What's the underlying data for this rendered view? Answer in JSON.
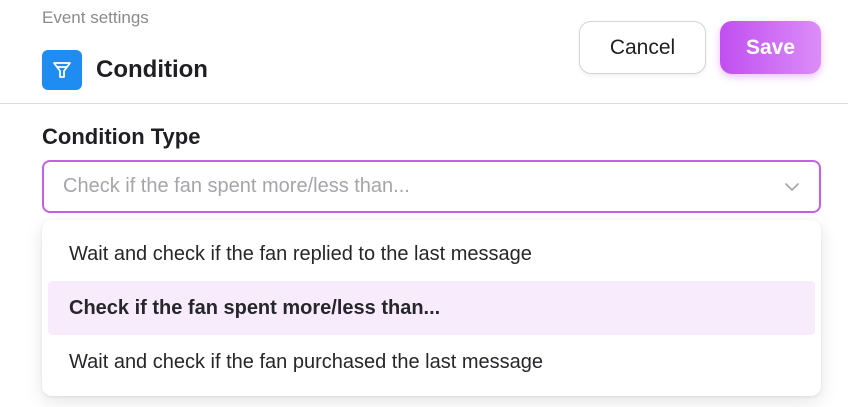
{
  "header": {
    "caption": "Event settings",
    "title": "Condition",
    "icon": "filter-icon"
  },
  "actions": {
    "cancel_label": "Cancel",
    "save_label": "Save"
  },
  "condition_type": {
    "label": "Condition Type",
    "placeholder": "Check if the fan spent more/less than...",
    "options": [
      {
        "label": "Wait and check if the fan replied to the last message",
        "selected": false
      },
      {
        "label": "Check if the fan spent more/less than...",
        "selected": true
      },
      {
        "label": "Wait and check if the fan purchased the last message",
        "selected": false
      }
    ]
  },
  "colors": {
    "accent": "#c85ee8",
    "icon_bg": "#1e8cf0",
    "selected_option_bg": "#f8ecfc",
    "save_gradient_start": "#c04ff0",
    "save_gradient_end": "#dc8cf8"
  }
}
